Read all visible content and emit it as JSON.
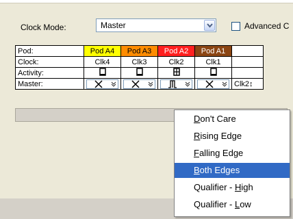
{
  "clock_mode": {
    "label": "Clock Mode:",
    "value": "Master"
  },
  "advanced": {
    "label": "Advanced C"
  },
  "table": {
    "rows": {
      "pod": {
        "label": "Pod:",
        "cells": [
          "Pod A4",
          "Pod A3",
          "Pod A2",
          "Pod A1"
        ]
      },
      "clock": {
        "label": "Clock:",
        "cells": [
          "Clk4",
          "Clk3",
          "Clk2",
          "Clk1"
        ]
      },
      "activity": {
        "label": "Activity:"
      },
      "master": {
        "label": "Master:",
        "extra": "Clk2↕"
      }
    },
    "pod_colors": [
      "#FFFF00",
      "#FF8C00",
      "#FF2020",
      "#8B4513"
    ]
  },
  "menu": {
    "items": [
      {
        "pre": "",
        "u": "D",
        "post": "on't Care"
      },
      {
        "pre": "",
        "u": "R",
        "post": "ising Edge"
      },
      {
        "pre": "",
        "u": "F",
        "post": "alling Edge"
      },
      {
        "pre": "",
        "u": "B",
        "post": "oth Edges"
      },
      {
        "pre": "Qualifier - ",
        "u": "H",
        "post": "igh"
      },
      {
        "pre": "Qualifier - ",
        "u": "L",
        "post": "ow"
      }
    ],
    "selected_index": 3
  }
}
